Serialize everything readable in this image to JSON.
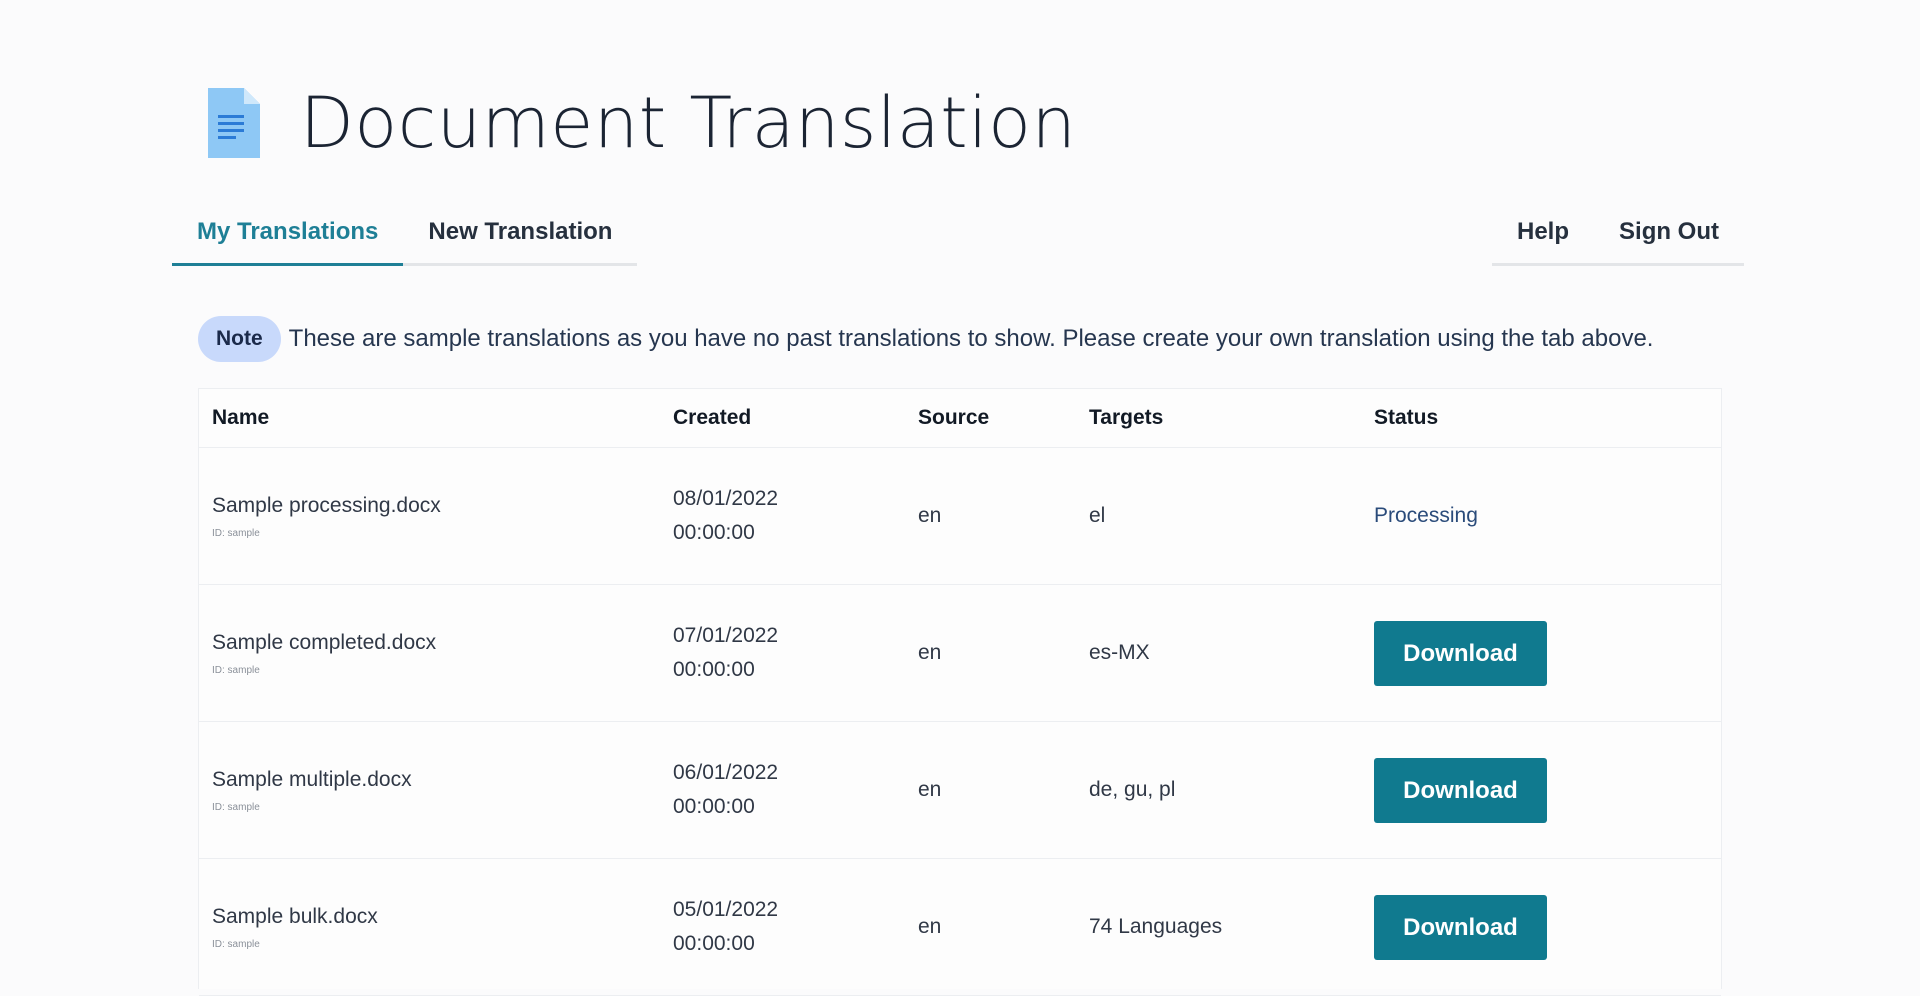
{
  "header": {
    "title": "Document Translation",
    "icon": "document-icon"
  },
  "nav": {
    "tabs": [
      {
        "label": "My Translations",
        "active": true
      },
      {
        "label": "New Translation",
        "active": false
      }
    ],
    "right": [
      {
        "label": "Help"
      },
      {
        "label": "Sign Out"
      }
    ]
  },
  "note": {
    "badge": "Note",
    "text": "These are sample translations as you have no past translations to show. Please create your own translation using the tab above."
  },
  "table": {
    "columns": [
      "Name",
      "Created",
      "Source",
      "Targets",
      "Status"
    ],
    "rows": [
      {
        "name": "Sample processing.docx",
        "id": "ID: sample",
        "date": "08/01/2022",
        "time": "00:00:00",
        "source": "en",
        "targets": "el",
        "status": "Processing",
        "action": ""
      },
      {
        "name": "Sample completed.docx",
        "id": "ID: sample",
        "date": "07/01/2022",
        "time": "00:00:00",
        "source": "en",
        "targets": "es-MX",
        "status": "",
        "action": "Download"
      },
      {
        "name": "Sample multiple.docx",
        "id": "ID: sample",
        "date": "06/01/2022",
        "time": "00:00:00",
        "source": "en",
        "targets": "de, gu, pl",
        "status": "",
        "action": "Download"
      },
      {
        "name": "Sample bulk.docx",
        "id": "ID: sample",
        "date": "05/01/2022",
        "time": "00:00:00",
        "source": "en",
        "targets": "74 Languages",
        "status": "",
        "action": "Download"
      }
    ]
  },
  "colors": {
    "accent": "#1e7f96",
    "button": "#107a8f",
    "note_badge": "#c8d9fb",
    "icon_blue": "#8ec8f5"
  }
}
